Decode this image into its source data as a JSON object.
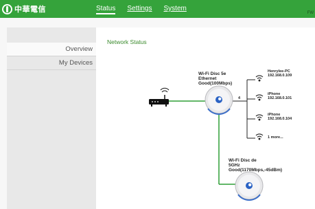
{
  "brand": {
    "logo_text": "中華電信"
  },
  "nav": {
    "status": "Status",
    "settings": "Settings",
    "system": "System"
  },
  "header": {
    "fw": "FW"
  },
  "sidebar": {
    "items": [
      {
        "label": "Overview"
      },
      {
        "label": "My Devices"
      }
    ]
  },
  "main": {
    "title": "Network Status"
  },
  "network": {
    "disc1": {
      "line1": "Wi-Fi Disc 5e",
      "line2": "Ethernet",
      "line3": "Good(100Mbps)"
    },
    "disc2": {
      "line1": "Wi-Fi Disc de",
      "line2": "5GHz",
      "line3": "Good(1170Mbps,-45dBm)"
    },
    "client_count": "4",
    "clients": [
      {
        "name": "Henrylee-PC",
        "ip": "192.168.0.109"
      },
      {
        "name": "iPhone",
        "ip": "192.168.0.101"
      },
      {
        "name": "iPhone",
        "ip": "192.168.0.104"
      },
      {
        "name": "1 more...",
        "ip": ""
      }
    ]
  },
  "colors": {
    "brand_green": "#35a33b",
    "link_green": "#3a8a2c",
    "line_green": "#2e9e36"
  }
}
